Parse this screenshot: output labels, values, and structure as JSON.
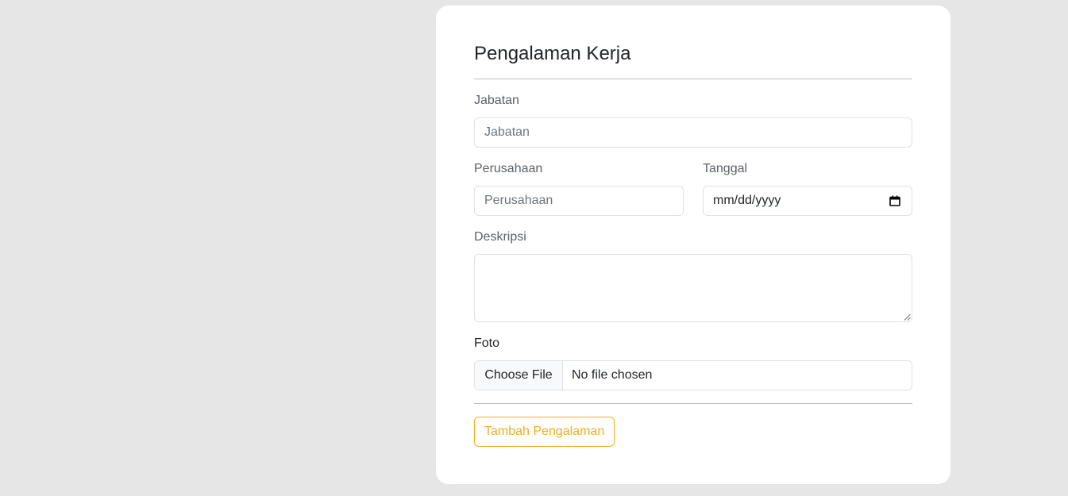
{
  "form": {
    "title": "Pengalaman Kerja",
    "jabatan": {
      "label": "Jabatan",
      "placeholder": "Jabatan",
      "value": ""
    },
    "perusahaan": {
      "label": "Perusahaan",
      "placeholder": "Perusahaan",
      "value": ""
    },
    "tanggal": {
      "label": "Tanggal",
      "display": "mm/dd/yyyy"
    },
    "deskripsi": {
      "label": "Deskripsi",
      "value": ""
    },
    "foto": {
      "label": "Foto",
      "button_label": "Choose File",
      "status": "No file chosen"
    },
    "submit_label": "Tambah Pengalaman"
  },
  "icons": {
    "date_picker": "calendar-icon",
    "textarea_resize": "resize-handle-icon"
  },
  "colors": {
    "page_background": "#e6e6e6",
    "card_background": "#ffffff",
    "accent": "#f0ad1e",
    "border": "#dee2e6"
  }
}
